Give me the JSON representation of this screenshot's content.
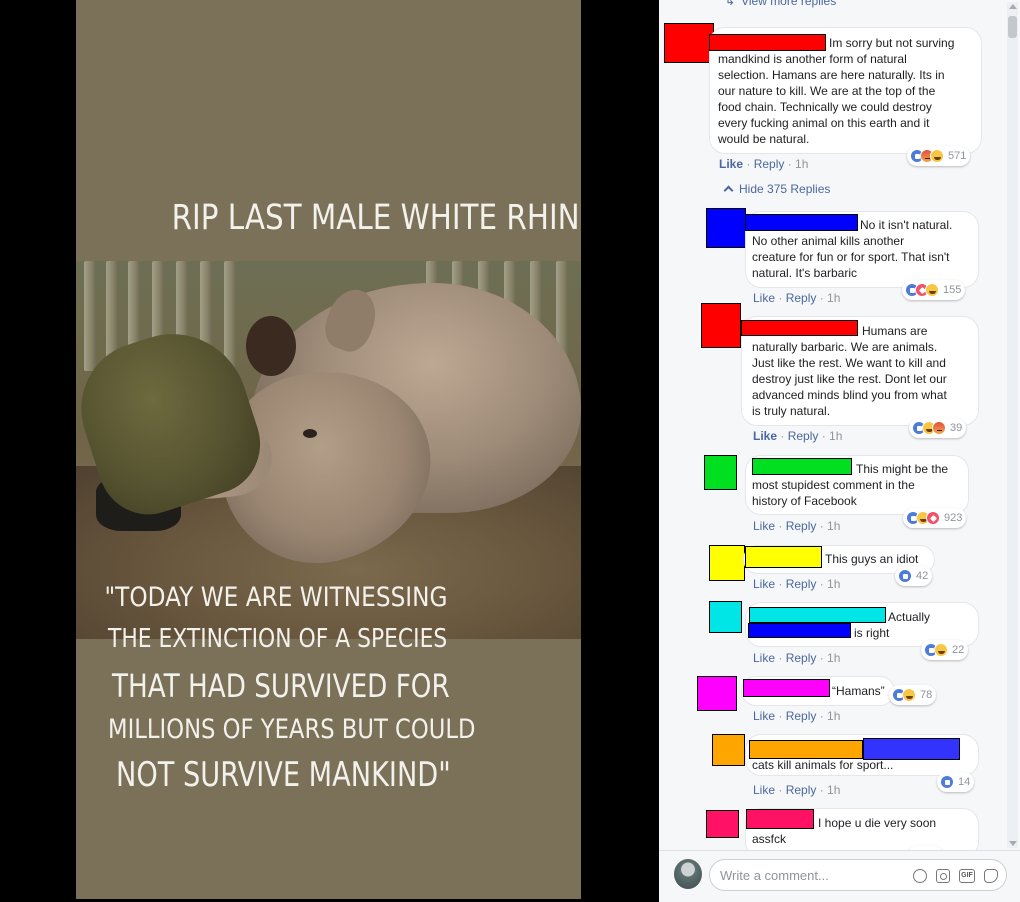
{
  "post": {
    "headline": "RIP LAST MALE WHITE RHINO",
    "quote_lines": [
      "\"TODAY WE ARE WITNESSING",
      "THE EXTINCTION OF A SPECIES",
      "THAT HAD SURVIVED FOR",
      "MILLIONS OF YEARS BUT COULD",
      "NOT SURVIVE MANKIND\""
    ]
  },
  "comments_panel": {
    "view_more": "View more replies",
    "hide_replies": "Hide 375 Replies",
    "colors": {
      "red": "#ff0000",
      "blue": "#0000ff",
      "green": "#00e020",
      "yellow": "#ffff00",
      "cyan": "#00e5e5",
      "magenta": "#ff00ff",
      "orange": "#ffa500",
      "indigo": "#3333ff",
      "crimson": "#ff1166"
    },
    "comments": [
      {
        "lines": [
          "Im sorry but not surving",
          "mandkind is another form of natural",
          "selection. Hamans are here naturally. Its in",
          "our nature to kill. We are at the top of the",
          "food chain. Technically we could destroy",
          "every fucking animal on this earth and it",
          "would be natural."
        ],
        "like": "Like",
        "reply": "Reply",
        "time": "1h",
        "reactions": [
          "like",
          "angry",
          "haha"
        ],
        "count": "571"
      },
      {
        "lines": [
          "No it isn't natural.",
          "No other animal kills another",
          "creature for fun or for sport. That isn't",
          "natural. It's barbaric"
        ],
        "like": "Like",
        "reply": "Reply",
        "time": "1h",
        "reactions": [
          "like",
          "love",
          "haha"
        ],
        "count": "155"
      },
      {
        "lines": [
          "Humans are",
          "naturally barbaric. We are animals.",
          "Just like the rest. We want to kill and",
          "destroy just like the rest. Dont let our",
          "advanced minds blind you from what",
          "is truly natural."
        ],
        "like": "Like",
        "reply": "Reply",
        "time": "1h",
        "reactions": [
          "like",
          "haha",
          "angry"
        ],
        "count": "39"
      },
      {
        "lines": [
          "This might be the",
          "most stupidest comment in the",
          "history of Facebook"
        ],
        "like": "Like",
        "reply": "Reply",
        "time": "1h",
        "reactions": [
          "like",
          "haha",
          "love"
        ],
        "count": "923"
      },
      {
        "lines": [
          "This guys an idiot"
        ],
        "like": "Like",
        "reply": "Reply",
        "time": "1h",
        "reactions": [
          "like"
        ],
        "count": "42"
      },
      {
        "lines": [
          "Actually",
          "is right"
        ],
        "like": "Like",
        "reply": "Reply",
        "time": "1h",
        "reactions": [
          "like",
          "haha"
        ],
        "count": "22"
      },
      {
        "lines": [
          "“Hamans”"
        ],
        "like": "Like",
        "reply": "Reply",
        "time": "1h",
        "reactions": [
          "like",
          "haha"
        ],
        "count": "78"
      },
      {
        "lines": [
          "cats kill animals for sport..."
        ],
        "like": "Like",
        "reply": "Reply",
        "time": "1h",
        "reactions": [
          "like"
        ],
        "count": "14"
      },
      {
        "lines": [
          "I hope u die very soon",
          "assfck"
        ]
      }
    ]
  },
  "composer": {
    "placeholder": "Write a comment...",
    "gif_label": "GIF"
  }
}
